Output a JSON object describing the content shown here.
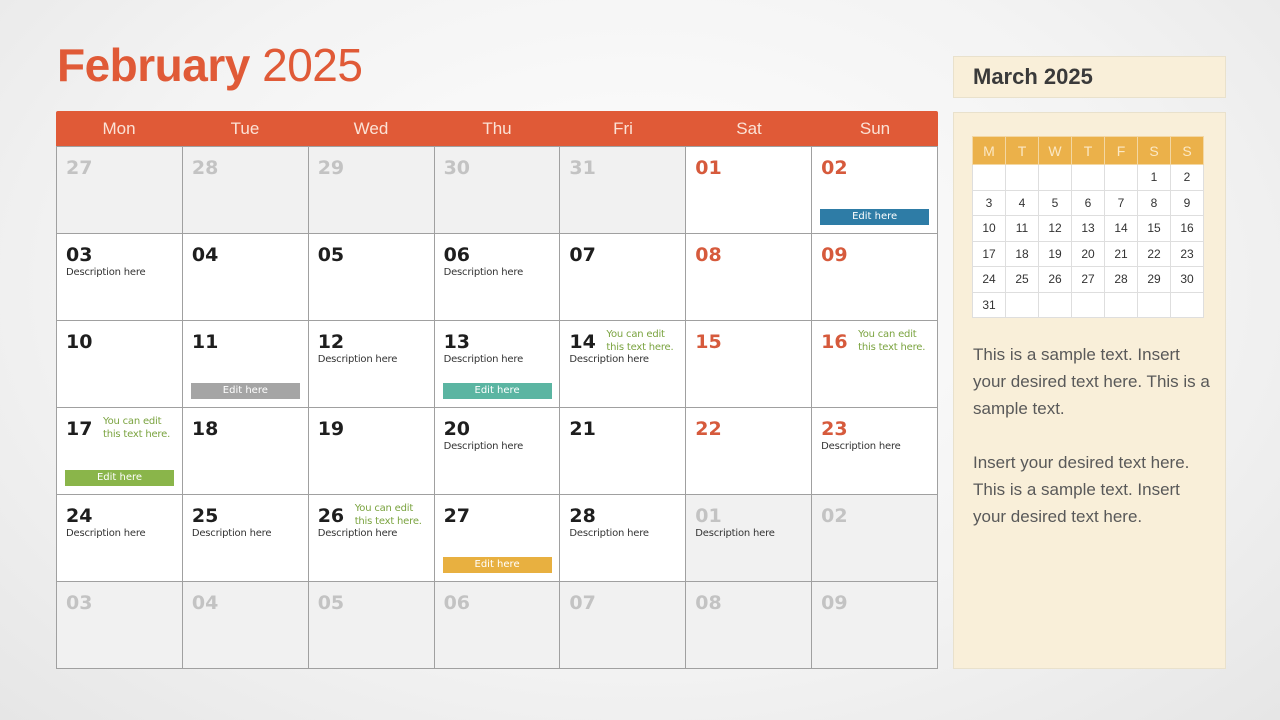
{
  "header": {
    "month": "February",
    "year": "2025"
  },
  "weekdays": [
    "Mon",
    "Tue",
    "Wed",
    "Thu",
    "Fri",
    "Sat",
    "Sun"
  ],
  "colors": {
    "accent": "#e05a37",
    "tag_blue": "#2e7ca6",
    "tag_gray": "#a5a5a5",
    "tag_teal": "#5bb5a2",
    "tag_green": "#8ab54a",
    "tag_gold": "#e8b040",
    "note_green": "#7aa33f"
  },
  "days": [
    {
      "num": "27",
      "other": true
    },
    {
      "num": "28",
      "other": true
    },
    {
      "num": "29",
      "other": true
    },
    {
      "num": "30",
      "other": true
    },
    {
      "num": "31",
      "other": true
    },
    {
      "num": "01",
      "weekend": true
    },
    {
      "num": "02",
      "weekend": true,
      "tag": "Edit here",
      "tag_color": "#2e7ca6"
    },
    {
      "num": "03",
      "desc": "Description here"
    },
    {
      "num": "04"
    },
    {
      "num": "05"
    },
    {
      "num": "06",
      "desc": "Description here"
    },
    {
      "num": "07"
    },
    {
      "num": "08",
      "weekend": true
    },
    {
      "num": "09",
      "weekend": true
    },
    {
      "num": "10"
    },
    {
      "num": "11",
      "tag": "Edit here",
      "tag_color": "#a5a5a5"
    },
    {
      "num": "12",
      "desc": "Description here"
    },
    {
      "num": "13",
      "desc": "Description here",
      "tag": "Edit here",
      "tag_color": "#5bb5a2"
    },
    {
      "num": "14",
      "desc": "Description here",
      "note": "You can edit this text here."
    },
    {
      "num": "15",
      "weekend": true
    },
    {
      "num": "16",
      "weekend": true,
      "note": "You can edit this text here."
    },
    {
      "num": "17",
      "note": "You can edit this text here.",
      "tag": "Edit here",
      "tag_color": "#8ab54a"
    },
    {
      "num": "18"
    },
    {
      "num": "19"
    },
    {
      "num": "20",
      "desc": "Description here"
    },
    {
      "num": "21"
    },
    {
      "num": "22",
      "weekend": true
    },
    {
      "num": "23",
      "weekend": true,
      "desc": "Description here"
    },
    {
      "num": "24",
      "desc": "Description here"
    },
    {
      "num": "25",
      "desc": "Description here"
    },
    {
      "num": "26",
      "desc": "Description here",
      "note": "You can edit this text here."
    },
    {
      "num": "27",
      "tag": "Edit here",
      "tag_color": "#e8b040"
    },
    {
      "num": "28",
      "desc": "Description here"
    },
    {
      "num": "01",
      "other": true,
      "desc": "Description here"
    },
    {
      "num": "02",
      "other": true
    },
    {
      "num": "03",
      "other": true
    },
    {
      "num": "04",
      "other": true
    },
    {
      "num": "05",
      "other": true
    },
    {
      "num": "06",
      "other": true
    },
    {
      "num": "07",
      "other": true
    },
    {
      "num": "08",
      "other": true
    },
    {
      "num": "09",
      "other": true
    }
  ],
  "sidebar": {
    "title": "March 2025",
    "mini_headers": [
      "M",
      "T",
      "W",
      "T",
      "F",
      "S",
      "S"
    ],
    "mini_weeks": [
      [
        "",
        "",
        "",
        "",
        "",
        "1",
        "2"
      ],
      [
        "3",
        "4",
        "5",
        "6",
        "7",
        "8",
        "9"
      ],
      [
        "10",
        "11",
        "12",
        "13",
        "14",
        "15",
        "16"
      ],
      [
        "17",
        "18",
        "19",
        "20",
        "21",
        "22",
        "23"
      ],
      [
        "24",
        "25",
        "26",
        "27",
        "28",
        "29",
        "30"
      ],
      [
        "31",
        "",
        "",
        "",
        "",
        "",
        ""
      ]
    ],
    "paragraphs": [
      "This is a sample text. Insert your desired text here. This is a sample text.",
      "Insert your desired text here. This is a sample text. Insert your desired text here."
    ]
  }
}
